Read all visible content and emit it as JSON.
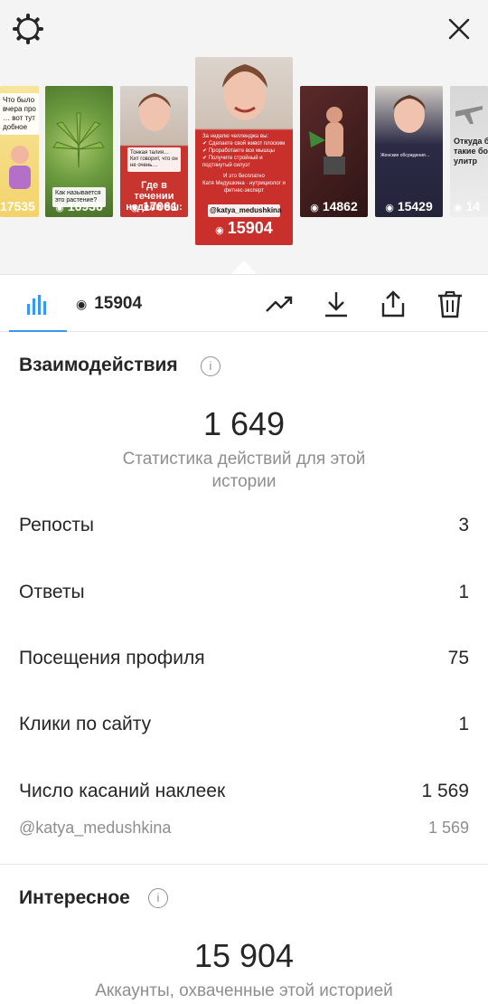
{
  "stories": [
    {
      "views": "17535",
      "caption": "Что было вчера про … вот тут добное"
    },
    {
      "views": "16936",
      "caption": "Как называется это растение?"
    },
    {
      "views": "17061",
      "caption": "Где в течении недели вы:"
    },
    {
      "views": "15904",
      "caption": "@katya_medushkina"
    },
    {
      "views": "14862",
      "caption": ""
    },
    {
      "views": "15429",
      "caption": ""
    },
    {
      "views": "14",
      "caption": "Откуда б такие бо улитр"
    }
  ],
  "tabs": {
    "views_count": "15904"
  },
  "interactions": {
    "title": "Взаимодействия",
    "total": "1 649",
    "subtitle": "Статистика действий для этой истории",
    "rows": [
      {
        "label": "Репосты",
        "value": "3"
      },
      {
        "label": "Ответы",
        "value": "1"
      },
      {
        "label": "Посещения профиля",
        "value": "75"
      },
      {
        "label": "Клики по сайту",
        "value": "1"
      },
      {
        "label": "Число касаний наклеек",
        "value": "1 569"
      }
    ],
    "sticker_account": {
      "label": "@katya_medushkina",
      "value": "1 569"
    }
  },
  "discovery": {
    "title": "Интересное",
    "total": "15 904",
    "subtitle": "Аккаунты, охваченные этой историей"
  },
  "colors": {
    "accent": "#3897f0",
    "center_story": "#c9302c"
  },
  "icons": {
    "settings": "gear-icon",
    "close": "close-icon",
    "insights": "bar-chart-icon",
    "eye": "eye-icon",
    "trend": "trending-up-icon",
    "download": "download-icon",
    "share": "share-icon",
    "delete": "trash-icon"
  }
}
